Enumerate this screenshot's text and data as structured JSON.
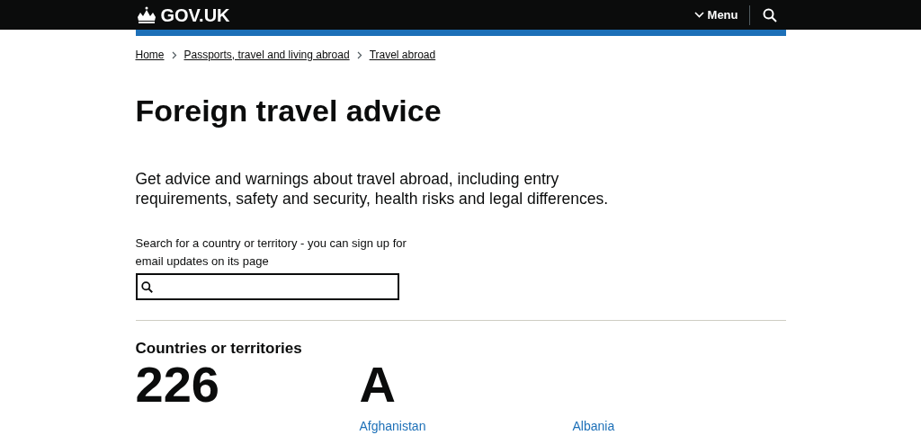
{
  "header": {
    "logo": "GOV.UK",
    "menu_button": "Menu"
  },
  "breadcrumbs": [
    "Home",
    "Passports, travel and living abroad",
    "Travel abroad"
  ],
  "title": "Foreign travel advice",
  "lead": "Get advice and warnings about travel abroad, including entry requirements, safety and security, health risks and legal differences.",
  "search": {
    "label": "Search for a country or territory - you can sign up for email updates on its page"
  },
  "count": {
    "label": "Countries or territories",
    "value": "226"
  },
  "letter_groups": [
    {
      "letter": "A",
      "countries": [
        "Afghanistan",
        "Albania"
      ]
    }
  ]
}
